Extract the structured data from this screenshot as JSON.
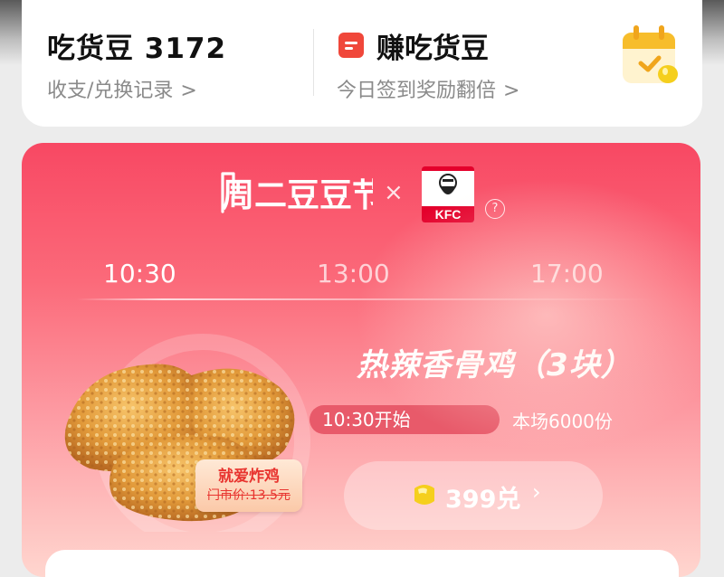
{
  "summary": {
    "beans_label": "吃货豆",
    "beans_count": "3172",
    "records_link": "收支/兑换记录",
    "earn_title": "赚吃货豆",
    "earn_sub": "今日签到奖励翻倍"
  },
  "promo": {
    "festival": "周二豆豆节",
    "brand": "KFC",
    "x_mark": "×",
    "help": "?",
    "tabs": [
      {
        "label": "10:30",
        "active": true
      },
      {
        "label": "13:00",
        "active": false
      },
      {
        "label": "17:00",
        "active": false
      }
    ],
    "product_name": "热辣香骨鸡（3块）",
    "start_time": "10:30开始",
    "stock": "本场6000份",
    "tag_title": "就爱炸鸡",
    "tag_price": "门市价:13.5元",
    "redeem_label": "399兑",
    "chevron": "›"
  },
  "colors": {
    "accent": "#f84863",
    "earn_icon": "#f0473a",
    "coin": "#f5cf1d"
  },
  "icons": [
    "chevron-right-icon",
    "earn-icon",
    "calendar-check-icon",
    "kfc-logo",
    "help-icon",
    "coin-icon"
  ]
}
